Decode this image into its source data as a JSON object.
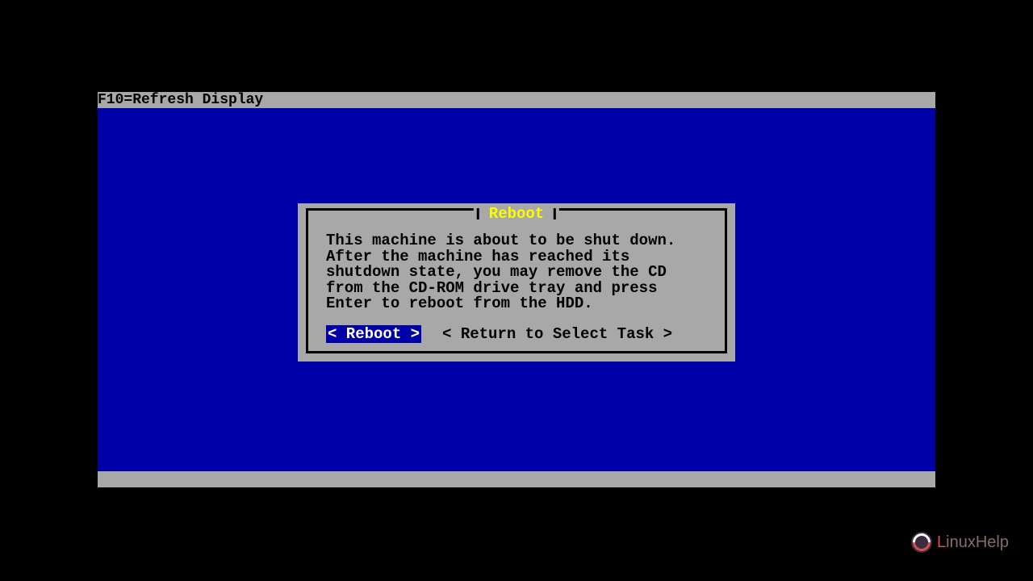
{
  "header": {
    "hint": "F10=Refresh Display"
  },
  "dialog": {
    "title": "Reboot",
    "body": "This machine is about to be shut down. After the machine has reached its shutdown state, you may remove the CD from the CD-ROM drive tray and press Enter to reboot from the HDD.",
    "reboot_label": "< Reboot >",
    "return_label": "< Return to Select Task >"
  },
  "watermark": {
    "prefix": "L",
    "rest": "inuxHelp"
  }
}
